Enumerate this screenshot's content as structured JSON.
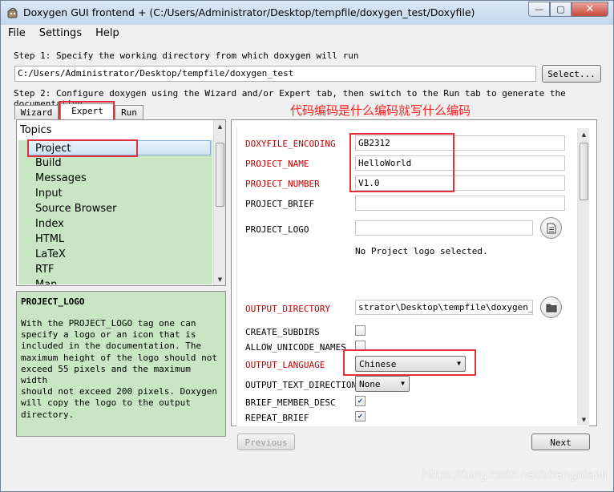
{
  "window": {
    "title": "Doxygen GUI frontend + (C:/Users/Administrator/Desktop/tempfile/doxygen_test/Doxyfile)",
    "minimize": "—",
    "maximize": "▢",
    "close": "✕"
  },
  "menu": {
    "file": "File",
    "settings": "Settings",
    "help": "Help"
  },
  "step1": {
    "label": "Step 1: Specify the working directory from which doxygen will run",
    "dir": "C:/Users/Administrator/Desktop/tempfile/doxygen_test",
    "select_label": "Select..."
  },
  "step2": {
    "label": "Step 2: Configure doxygen using the Wizard and/or Expert tab, then switch to the Run tab to generate the documentation"
  },
  "tabs": [
    {
      "label": "Wizard"
    },
    {
      "label": "Expert"
    },
    {
      "label": "Run"
    }
  ],
  "annotation": "代码编码是什么编码就写什么编码",
  "topics": {
    "header": "Topics",
    "items": [
      "Project",
      "Build",
      "Messages",
      "Input",
      "Source Browser",
      "Index",
      "HTML",
      "LaTeX",
      "RTF",
      "Man"
    ]
  },
  "help": {
    "title": "PROJECT_LOGO",
    "text": "With the PROJECT_LOGO tag one can\nspecify a logo or an icon that is\nincluded in the documentation. The\nmaximum height of the logo should not\nexceed 55 pixels and the maximum width\nshould not exceed 200 pixels. Doxygen\nwill copy the logo to the output\ndirectory."
  },
  "options": {
    "doxyfile_encoding": {
      "label": "DOXYFILE_ENCODING",
      "value": "GB2312"
    },
    "project_name": {
      "label": "PROJECT_NAME",
      "value": "HelloWorld"
    },
    "project_number": {
      "label": "PROJECT_NUMBER",
      "value": "V1.0"
    },
    "project_brief": {
      "label": "PROJECT_BRIEF",
      "value": ""
    },
    "project_logo": {
      "label": "PROJECT_LOGO",
      "value": "",
      "status": "No Project logo selected."
    },
    "output_directory": {
      "label": "OUTPUT_DIRECTORY",
      "value": "strator\\Desktop\\tempfile\\doxygen_test"
    },
    "create_subdirs": {
      "label": "CREATE_SUBDIRS",
      "checked": false
    },
    "allow_unicode_names": {
      "label": "ALLOW_UNICODE_NAMES",
      "checked": false
    },
    "output_language": {
      "label": "OUTPUT_LANGUAGE",
      "value": "Chinese"
    },
    "output_text_direction": {
      "label": "OUTPUT_TEXT_DIRECTION",
      "value": "None"
    },
    "brief_member_desc": {
      "label": "BRIEF_MEMBER_DESC",
      "checked": true
    },
    "repeat_brief": {
      "label": "REPEAT_BRIEF",
      "checked": true
    }
  },
  "nav": {
    "previous": "Previous",
    "next": "Next"
  },
  "watermark": "https://blog.csdn.net/zhengnianli",
  "colors": {
    "annotation": "#ff2020",
    "modified_label": "#c00000",
    "list_bg": "#c8e6c4",
    "highlight_box": "#e0303a"
  }
}
